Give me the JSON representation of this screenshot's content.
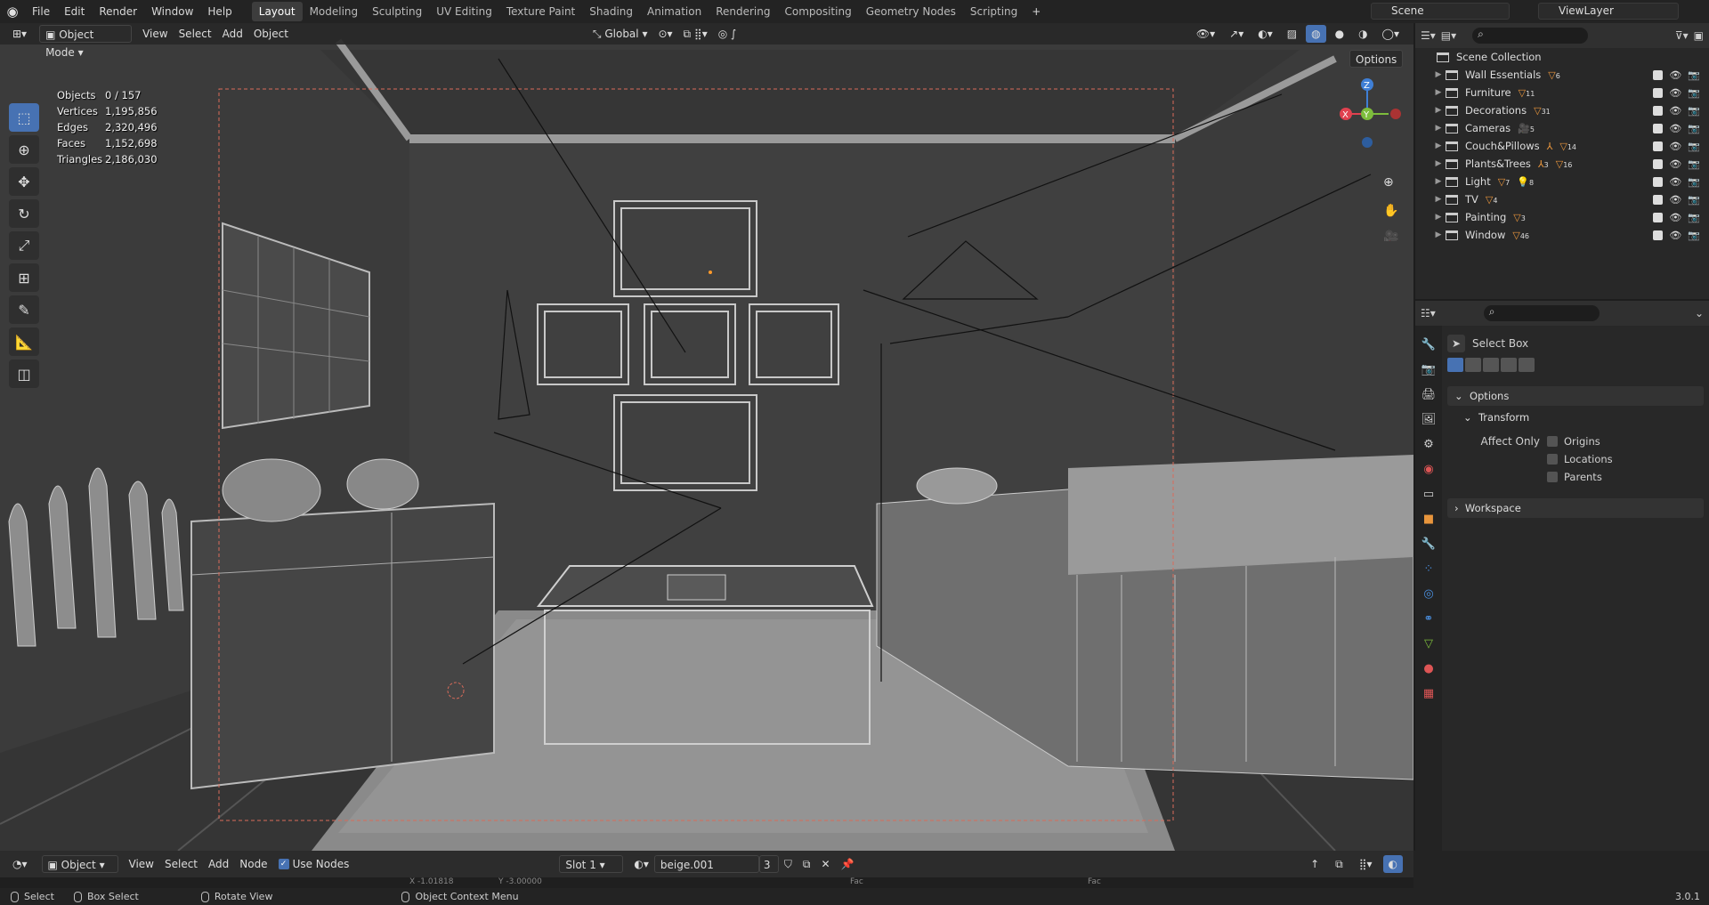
{
  "menus": [
    "File",
    "Edit",
    "Render",
    "Window",
    "Help"
  ],
  "workspaces": [
    "Layout",
    "Modeling",
    "Sculpting",
    "UV Editing",
    "Texture Paint",
    "Shading",
    "Animation",
    "Rendering",
    "Compositing",
    "Geometry Nodes",
    "Scripting"
  ],
  "active_workspace": "Layout",
  "scene_name": "Scene",
  "view_layer": "ViewLayer",
  "viewport": {
    "mode": "Object Mode",
    "menus": [
      "View",
      "Select",
      "Add",
      "Object"
    ],
    "transform_orientation": "Global",
    "options_label": "Options",
    "stats": [
      {
        "label": "Objects",
        "value": "0 / 157"
      },
      {
        "label": "Vertices",
        "value": "1,195,856"
      },
      {
        "label": "Edges",
        "value": "2,320,496"
      },
      {
        "label": "Faces",
        "value": "1,152,698"
      },
      {
        "label": "Triangles",
        "value": "2,186,030"
      }
    ],
    "gizmo": {
      "x": "X",
      "y": "Y",
      "z": "Z"
    }
  },
  "outliner": {
    "root": "Scene Collection",
    "collections": [
      {
        "name": "Wall Essentials",
        "badges": [
          {
            "icon": "mesh-icon",
            "count": "6"
          }
        ]
      },
      {
        "name": "Furniture",
        "badges": [
          {
            "icon": "mesh-icon",
            "count": "11"
          }
        ]
      },
      {
        "name": "Decorations",
        "badges": [
          {
            "icon": "mesh-icon",
            "count": "31"
          }
        ]
      },
      {
        "name": "Cameras",
        "badges": [
          {
            "icon": "camera-icon",
            "count": "5"
          }
        ]
      },
      {
        "name": "Couch&Pillows",
        "badges": [
          {
            "icon": "empty-icon",
            "count": ""
          },
          {
            "icon": "mesh-icon",
            "count": "14"
          }
        ]
      },
      {
        "name": "Plants&Trees",
        "badges": [
          {
            "icon": "empty-icon",
            "count": "3"
          },
          {
            "icon": "mesh-icon",
            "count": "16"
          }
        ]
      },
      {
        "name": "Light",
        "badges": [
          {
            "icon": "mesh-icon",
            "count": "7"
          },
          {
            "icon": "light-icon",
            "count": "8"
          }
        ]
      },
      {
        "name": "TV",
        "badges": [
          {
            "icon": "mesh-icon",
            "count": "4"
          }
        ]
      },
      {
        "name": "Painting",
        "badges": [
          {
            "icon": "mesh-icon",
            "count": "3"
          }
        ]
      },
      {
        "name": "Window",
        "badges": [
          {
            "icon": "mesh-icon",
            "count": "46"
          }
        ]
      }
    ]
  },
  "properties": {
    "tool_name": "Select Box",
    "options_label": "Options",
    "transform_label": "Transform",
    "affect_only_label": "Affect Only",
    "affect_only": [
      "Origins",
      "Locations",
      "Parents"
    ],
    "workspace_label": "Workspace"
  },
  "node_editor": {
    "editor_type": "Object",
    "menus": [
      "View",
      "Select",
      "Add",
      "Node"
    ],
    "use_nodes_label": "Use Nodes",
    "slot": "Slot 1",
    "material": "beige.001",
    "users": "3",
    "strip_labels": [
      "X -1.01818",
      "Y -3.00000",
      "Fac",
      "Fac"
    ]
  },
  "statusbar": {
    "items": [
      "Select",
      "Box Select",
      "Rotate View",
      "Object Context Menu"
    ],
    "version": "3.0.1"
  },
  "colors": {
    "accent": "#4772b3",
    "orange": "#e8953c",
    "x_axis": "#e0414f",
    "y_axis": "#7dbd3c",
    "z_axis": "#3f7fd6"
  }
}
